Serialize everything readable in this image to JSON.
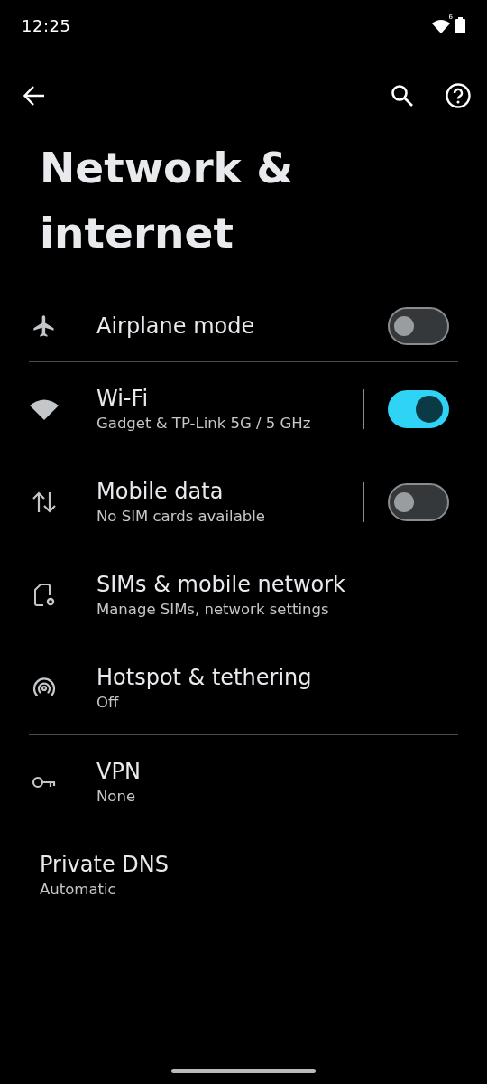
{
  "status_bar": {
    "time": "12:25",
    "wifi_badge": "6"
  },
  "title": "Network & internet",
  "sections": [
    [
      {
        "kind": "toggle",
        "title": "Airplane mode",
        "on": false
      }
    ],
    [
      {
        "kind": "split_toggle",
        "title": "Wi-Fi",
        "subtitle": "Gadget & TP-Link 5G / 5 GHz",
        "on": true
      },
      {
        "kind": "split_toggle",
        "title": "Mobile data",
        "subtitle": "No SIM cards available",
        "on": false
      },
      {
        "kind": "link",
        "title": "SIMs & mobile network",
        "subtitle": "Manage SIMs, network settings"
      },
      {
        "kind": "link",
        "title": "Hotspot & tethering",
        "subtitle": "Off"
      }
    ],
    [
      {
        "kind": "link",
        "title": "VPN",
        "subtitle": "None"
      },
      {
        "kind": "plain",
        "title": "Private DNS",
        "subtitle": "Automatic"
      }
    ]
  ]
}
